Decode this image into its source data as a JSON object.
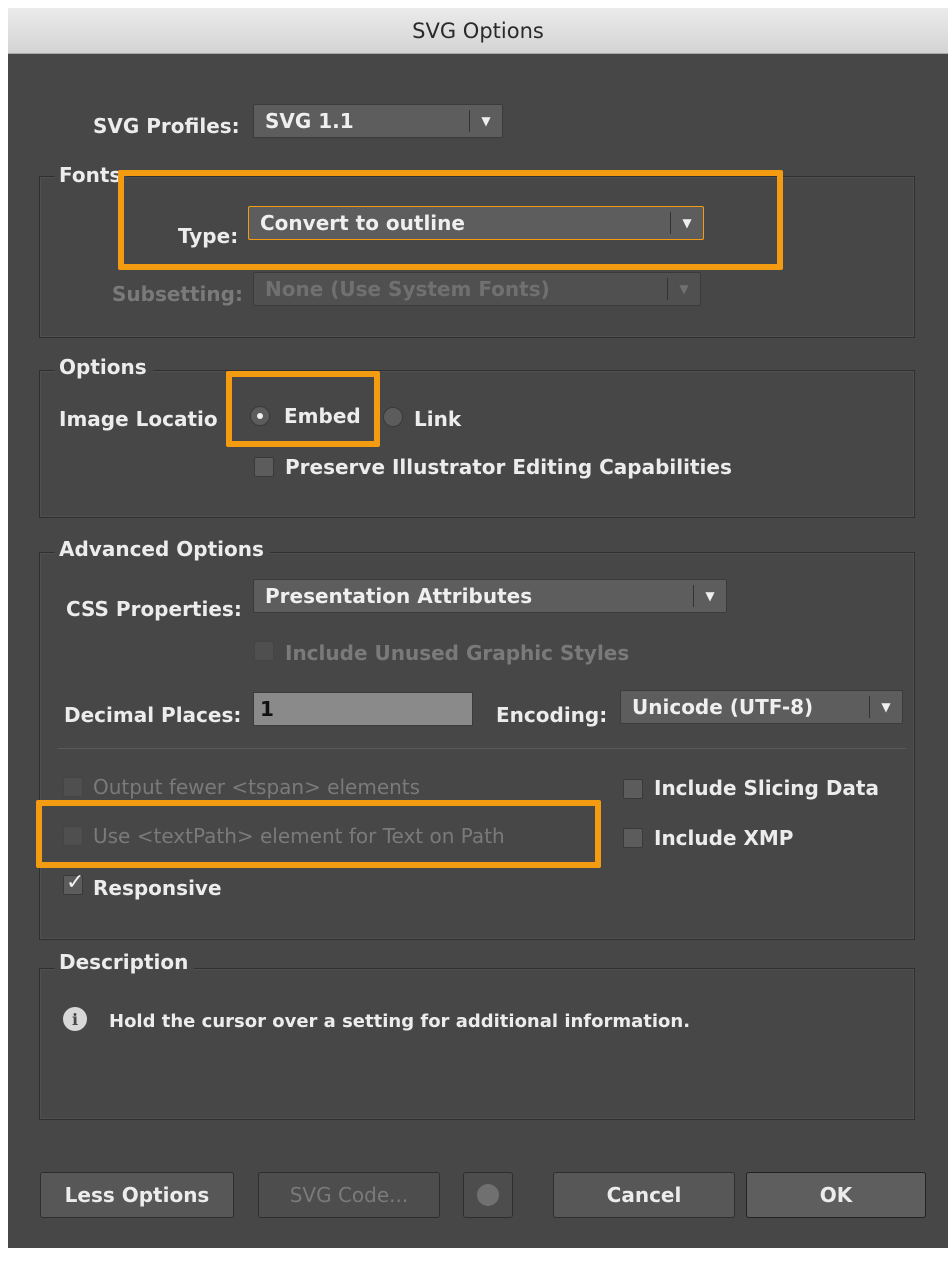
{
  "window": {
    "title": "SVG Options"
  },
  "svg_profiles": {
    "label": "SVG Profiles:",
    "value": "SVG 1.1"
  },
  "fonts": {
    "legend": "Fonts",
    "type_label": "Type:",
    "type_value": "Convert to outline",
    "subsetting_label": "Subsetting:",
    "subsetting_value": "None (Use System Fonts)"
  },
  "options": {
    "legend": "Options",
    "image_location_label": "Image Locatio",
    "embed_label": "Embed",
    "link_label": "Link",
    "embed_selected": true,
    "preserve_label": "Preserve Illustrator Editing Capabilities"
  },
  "advanced": {
    "legend": "Advanced Options",
    "css_label": "CSS Properties:",
    "css_value": "Presentation Attributes",
    "unused_styles_label": "Include Unused Graphic Styles",
    "decimal_label": "Decimal Places:",
    "decimal_value": "1",
    "encoding_label": "Encoding:",
    "encoding_value": "Unicode (UTF-8)",
    "fewer_tspan_label": "Output fewer <tspan> elements",
    "textpath_label": "Use <textPath> element for Text on Path",
    "responsive_label": "Responsive",
    "responsive_checked": true,
    "slicing_label": "Include Slicing Data",
    "xmp_label": "Include XMP"
  },
  "description": {
    "legend": "Description",
    "text": "Hold the cursor over a setting for additional information."
  },
  "buttons": {
    "less_options": "Less Options",
    "svg_code": "SVG Code...",
    "cancel": "Cancel",
    "ok": "OK"
  },
  "colors": {
    "highlight": "#f39c12",
    "dialog_bg": "#474747"
  }
}
